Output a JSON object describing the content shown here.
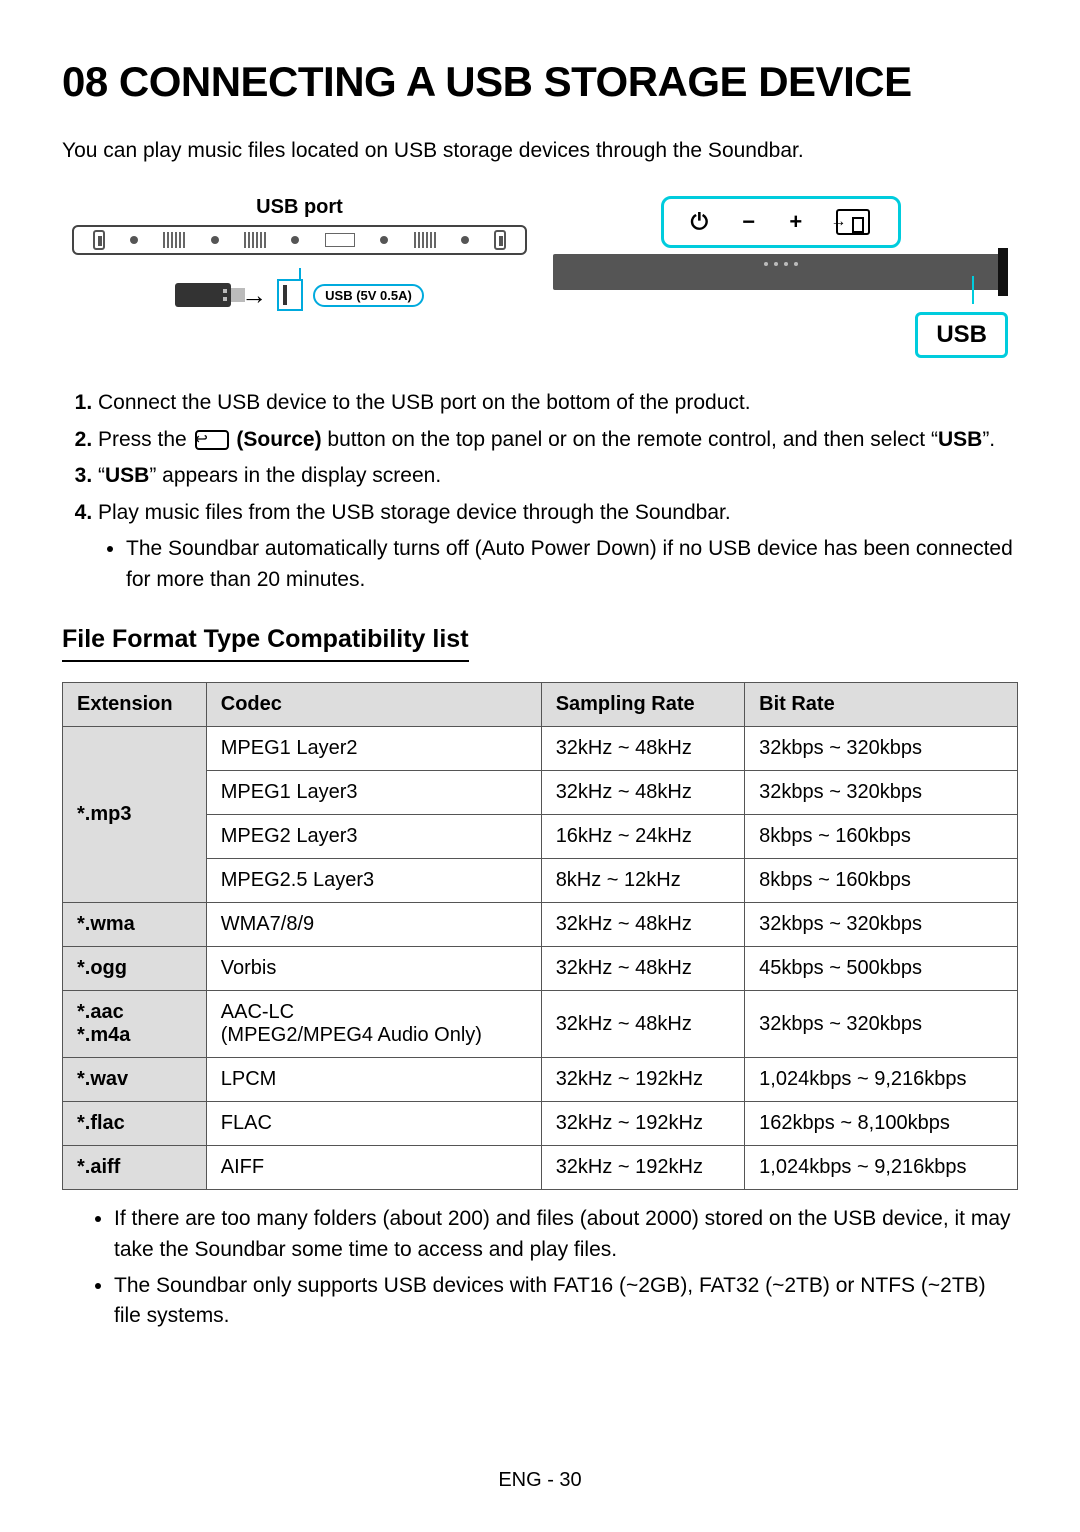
{
  "heading": "08 CONNECTING A USB STORAGE DEVICE",
  "intro": "You can play music files located on USB storage devices through the Soundbar.",
  "diagram": {
    "usb_port_label": "USB port",
    "usb_badge": "USB (5V 0.5A)",
    "usb_display": "USB",
    "remote_minus": "−",
    "remote_plus": "+"
  },
  "steps": {
    "s1": "Connect the USB device to the USB port on the bottom of the product.",
    "s2_a": "Press the ",
    "s2_source": " (Source)",
    "s2_b": " button on the top panel or on the remote control, and then select “",
    "s2_usb": "USB",
    "s2_c": "”.",
    "s3_a": "“",
    "s3_usb": "USB",
    "s3_b": "” appears in the display screen.",
    "s4": "Play music files from the USB storage device through the Soundbar.",
    "s4_sub": "The Soundbar automatically turns off (Auto Power Down) if no USB device has been connected for more than 20 minutes."
  },
  "compat_heading": "File Format Type Compatibility list",
  "table": {
    "headers": {
      "ext": "Extension",
      "codec": "Codec",
      "rate": "Sampling Rate",
      "bit": "Bit Rate"
    },
    "rows": [
      {
        "ext": "*.mp3",
        "codec": "MPEG1 Layer2",
        "rate": "32kHz ~ 48kHz",
        "bit": "32kbps ~ 320kbps",
        "ext_rowspan": 4
      },
      {
        "codec": "MPEG1 Layer3",
        "rate": "32kHz ~ 48kHz",
        "bit": "32kbps ~ 320kbps"
      },
      {
        "codec": "MPEG2 Layer3",
        "rate": "16kHz ~ 24kHz",
        "bit": "8kbps ~ 160kbps"
      },
      {
        "codec": "MPEG2.5 Layer3",
        "rate": "8kHz ~ 12kHz",
        "bit": "8kbps ~ 160kbps"
      },
      {
        "ext": "*.wma",
        "codec": "WMA7/8/9",
        "rate": "32kHz ~ 48kHz",
        "bit": "32kbps ~ 320kbps"
      },
      {
        "ext": "*.ogg",
        "codec": "Vorbis",
        "rate": "32kHz ~ 48kHz",
        "bit": "45kbps ~ 500kbps"
      },
      {
        "ext": "*.aac\n*.m4a",
        "codec": "AAC-LC\n(MPEG2/MPEG4 Audio Only)",
        "rate": "32kHz ~ 48kHz",
        "bit": "32kbps ~ 320kbps"
      },
      {
        "ext": "*.wav",
        "codec": "LPCM",
        "rate": "32kHz ~ 192kHz",
        "bit": "1,024kbps ~ 9,216kbps"
      },
      {
        "ext": "*.flac",
        "codec": "FLAC",
        "rate": "32kHz ~ 192kHz",
        "bit": "162kbps ~ 8,100kbps"
      },
      {
        "ext": "*.aiff",
        "codec": "AIFF",
        "rate": "32kHz ~ 192kHz",
        "bit": "1,024kbps ~ 9,216kbps"
      }
    ]
  },
  "notes": {
    "n1": "If there are too many folders (about 200) and files (about 2000) stored on the USB device, it may take the Soundbar some time to access and play files.",
    "n2": "The Soundbar only supports USB devices with FAT16 (~2GB), FAT32 (~2TB) or NTFS (~2TB) file systems."
  },
  "footer": "ENG - 30"
}
